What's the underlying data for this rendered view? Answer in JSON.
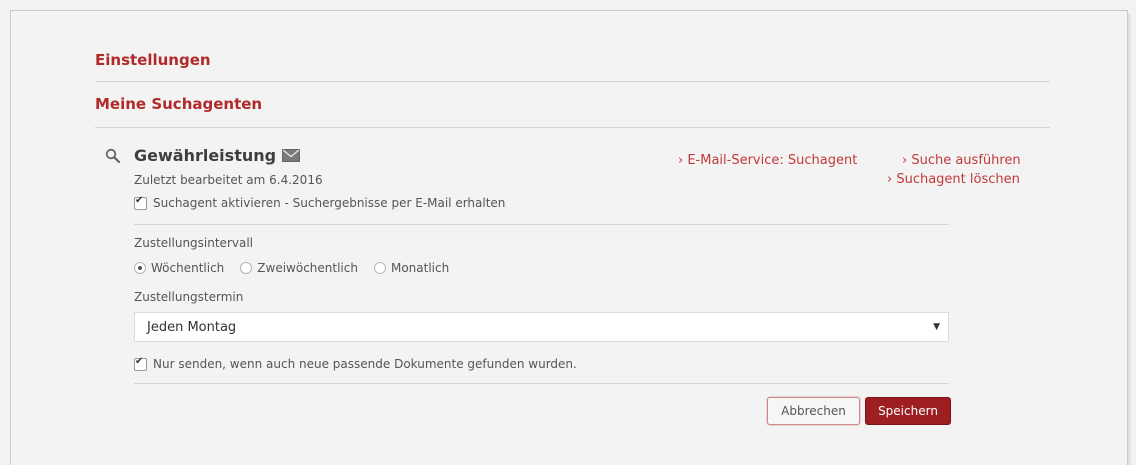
{
  "settings": {
    "title": "Einstellungen"
  },
  "agents": {
    "title": "Meine Suchagenten"
  },
  "agent": {
    "name": "Gewährleistung",
    "last_edited": "Zuletzt bearbeitet am 6.4.2016",
    "activate_label": "Suchagent aktivieren - Suchergebnisse per E-Mail erhalten",
    "activate_checked": true
  },
  "links": {
    "email_service": "› E-Mail-Service: Suchagent",
    "run_search": "› Suche ausführen",
    "delete_agent": "› Suchagent löschen"
  },
  "interval": {
    "label": "Zustellungsintervall",
    "options": [
      "Wöchentlich",
      "Zweiwöchentlich",
      "Monatlich"
    ],
    "selected": "Wöchentlich"
  },
  "schedule": {
    "label": "Zustellungstermin",
    "value": "Jeden Montag"
  },
  "only_new": {
    "label": "Nur senden, wenn auch neue passende Dokumente gefunden wurden.",
    "checked": true
  },
  "buttons": {
    "cancel": "Abbrechen",
    "save": "Speichern"
  },
  "colors": {
    "accent": "#b02a2a",
    "save_button": "#9e1f22"
  }
}
